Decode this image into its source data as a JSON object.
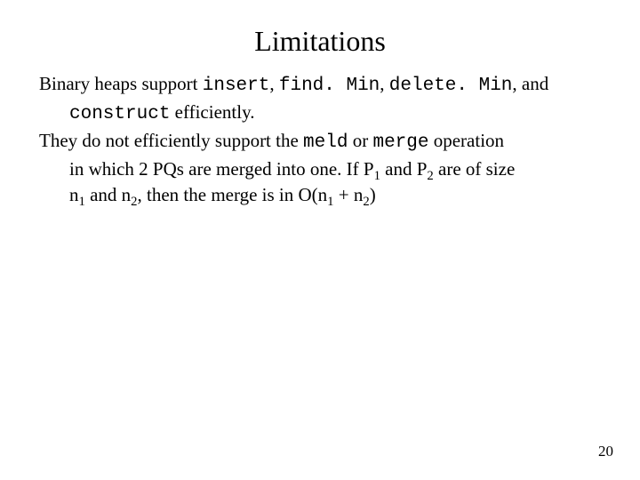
{
  "title": "Limitations",
  "line1": {
    "a": "Binary heaps support ",
    "insert": "insert",
    "b": ", ",
    "findmin": "find. Min",
    "c": ", ",
    "deletemin": "delete. Min",
    "d": ", and"
  },
  "line2": {
    "construct": "construct",
    "rest": " efficiently."
  },
  "line3": {
    "a": "They do not efficiently support the ",
    "meld": "meld",
    "b": " or ",
    "merge": "merge",
    "c": " operation"
  },
  "line4": {
    "a": "in which 2 PQs are merged into one. If P",
    "s1": "1",
    "b": " and P",
    "s2": "2",
    "c": " are of size"
  },
  "line5": {
    "a": "n",
    "s1": "1",
    "b": " and n",
    "s2": "2",
    "c": ", then the merge is in O(n",
    "s3": "1",
    "d": " + n",
    "s4": "2",
    "e": ")"
  },
  "page": "20"
}
